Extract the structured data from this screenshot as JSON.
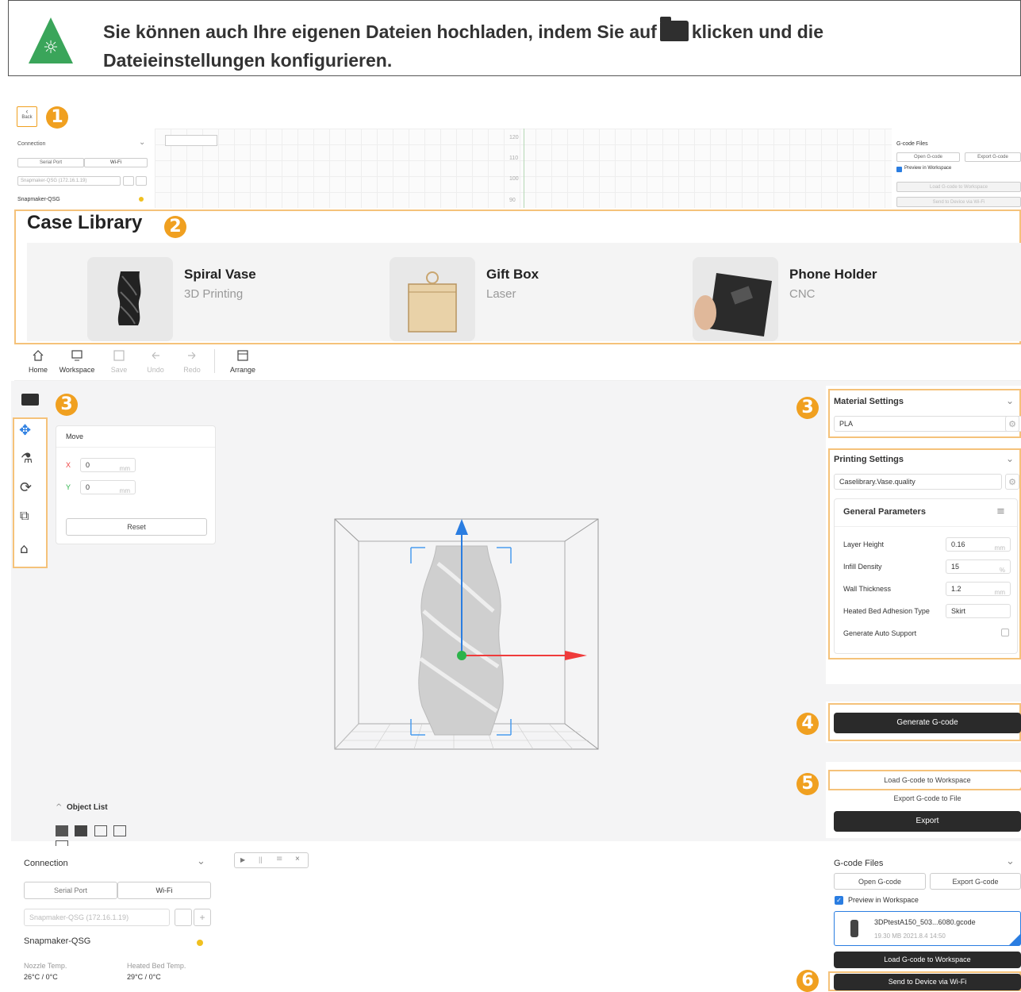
{
  "tip": {
    "text_before": "Sie können auch Ihre eigenen Dateien hochladen, indem Sie auf",
    "text_after": "klicken und die",
    "text_line2": "Dateieinstellungen konfigurieren.",
    "bulb_icon": "lightbulb-icon"
  },
  "badges": [
    "1",
    "2",
    "3",
    "3",
    "4",
    "5",
    "6"
  ],
  "top_strip": {
    "back_label": "Back",
    "connection_title": "Connection",
    "serial_tab": "Serial Port",
    "wifi_tab": "Wi-Fi",
    "device_select": "Snapmaker-QSG (172.16.1.19)",
    "device_name": "Snapmaker-QSG",
    "ruler": [
      "120",
      "110",
      "100",
      "90"
    ],
    "gcode_title": "G-code Files",
    "open_gcode": "Open G-code",
    "export_gcode": "Export G-code",
    "preview": "Preview in Workspace",
    "load_gcode": "Load G-code to Workspace",
    "send_wifi": "Send to Device via Wi-Fi"
  },
  "case_library": {
    "title": "Case Library",
    "cases": [
      {
        "name": "Spiral Vase",
        "type": "3D Printing"
      },
      {
        "name": "Gift Box",
        "type": "Laser"
      },
      {
        "name": "Phone Holder",
        "type": "CNC"
      }
    ]
  },
  "toolbar": {
    "items": [
      {
        "label": "Home",
        "icon": "home-icon",
        "enabled": true
      },
      {
        "label": "Workspace",
        "icon": "monitor-icon",
        "enabled": true
      },
      {
        "label": "Save",
        "icon": "save-icon",
        "enabled": false
      },
      {
        "label": "Undo",
        "icon": "undo-icon",
        "enabled": false
      },
      {
        "label": "Redo",
        "icon": "redo-icon",
        "enabled": false
      },
      {
        "label": "Arrange",
        "icon": "arrange-icon",
        "enabled": true
      }
    ]
  },
  "move_panel": {
    "title": "Move",
    "x_label": "X",
    "x_value": "0",
    "y_label": "Y",
    "y_value": "0",
    "unit": "mm",
    "reset": "Reset"
  },
  "object_list": {
    "title": "Object List"
  },
  "material": {
    "title": "Material Settings",
    "value": "PLA"
  },
  "printing": {
    "title": "Printing Settings",
    "value": "Caselibrary.Vase.quality",
    "general_title": "General Parameters",
    "params": [
      {
        "label": "Layer Height",
        "value": "0.16",
        "unit": "mm"
      },
      {
        "label": "Infill Density",
        "value": "15",
        "unit": "%"
      },
      {
        "label": "Wall Thickness",
        "value": "1.2",
        "unit": "mm"
      },
      {
        "label": "Heated Bed Adhesion Type",
        "value": "Skirt",
        "unit": ""
      }
    ],
    "auto_support": "Generate Auto Support"
  },
  "generate": {
    "label": "Generate G-code"
  },
  "export_panel": {
    "load": "Load G-code to Workspace",
    "export_file": "Export G-code to File",
    "export": "Export"
  },
  "bottom_connection": {
    "title": "Connection",
    "serial_tab": "Serial Port",
    "wifi_tab": "Wi-Fi",
    "device_select": "Snapmaker-QSG (172.16.1.19)",
    "device_name": "Snapmaker-QSG",
    "nozzle_label": "Nozzle Temp.",
    "nozzle_value": "26°C / 0°C",
    "bed_label": "Heated Bed Temp.",
    "bed_value": "29°C / 0°C"
  },
  "bottom_gcode": {
    "title": "G-code Files",
    "open": "Open G-code",
    "export": "Export G-code",
    "preview": "Preview in Workspace",
    "file_name": "3DPtestA150_503...6080.gcode",
    "file_meta": "19.30 MB   2021.8.4 14:50",
    "load": "Load G-code to Workspace",
    "send": "Send to Device via Wi-Fi"
  },
  "colors": {
    "accent_orange": "#f0a020",
    "tip_green": "#3aa55a",
    "highlight_border": "#f5c27a",
    "dark_button": "#2a2a2a",
    "axis_blue": "#2a7de1",
    "axis_red": "#ef3b3b",
    "axis_green": "#2cb34a"
  }
}
